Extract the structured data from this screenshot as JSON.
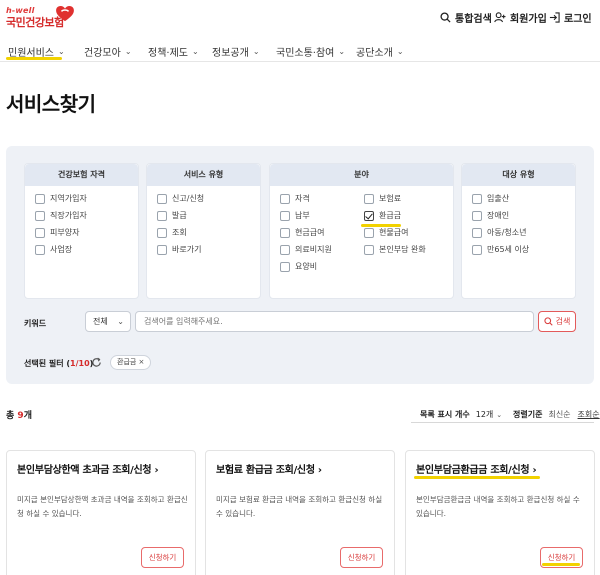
{
  "header": {
    "logo_tagline": "h-well",
    "logo_name": "국민건강보험",
    "search_label": "통합검색",
    "signup_label": "회원가입",
    "login_label": "로그인"
  },
  "nav": {
    "items": [
      {
        "label": "민원서비스",
        "active": true
      },
      {
        "label": "건강모아"
      },
      {
        "label": "정책·제도"
      },
      {
        "label": "정보공개"
      },
      {
        "label": "국민소통·참여"
      },
      {
        "label": "공단소개"
      }
    ]
  },
  "page_title": "서비스찾기",
  "filters": {
    "categories": [
      {
        "title": "건강보험 자격",
        "options": [
          {
            "label": "지역가입자",
            "checked": false
          },
          {
            "label": "직장가입자",
            "checked": false
          },
          {
            "label": "피부양자",
            "checked": false
          },
          {
            "label": "사업장",
            "checked": false
          }
        ]
      },
      {
        "title": "서비스 유형",
        "options": [
          {
            "label": "신고/신청",
            "checked": false
          },
          {
            "label": "발급",
            "checked": false
          },
          {
            "label": "조회",
            "checked": false
          },
          {
            "label": "바로가기",
            "checked": false
          }
        ]
      },
      {
        "title": "분야",
        "options": [
          {
            "label": "자격",
            "checked": false
          },
          {
            "label": "보험료",
            "checked": false
          },
          {
            "label": "납부",
            "checked": false
          },
          {
            "label": "환급금",
            "checked": true
          },
          {
            "label": "현금급여",
            "checked": false
          },
          {
            "label": "현물급여",
            "checked": false
          },
          {
            "label": "의료비지원",
            "checked": false
          },
          {
            "label": "본인부담 완화",
            "checked": false
          },
          {
            "label": "요양비",
            "checked": false
          }
        ]
      },
      {
        "title": "대상 유형",
        "options": [
          {
            "label": "임출산",
            "checked": false
          },
          {
            "label": "장애인",
            "checked": false
          },
          {
            "label": "아동/청소년",
            "checked": false
          },
          {
            "label": "만65세 이상",
            "checked": false
          }
        ]
      }
    ],
    "keyword_label": "키워드",
    "keyword_scope": "전체",
    "keyword_placeholder": "검색어를 입력해주세요.",
    "search_button": "검색",
    "selected_label": "선택된 필터",
    "selected_count": "1/10",
    "selected_chips": [
      "환급금 ×"
    ]
  },
  "results": {
    "total_prefix": "총 ",
    "total_count": "9",
    "total_suffix": "개",
    "per_page_label": "목록 표시 개수",
    "per_page_value": "12개",
    "sort_label": "정렬기준",
    "sort_latest": "최신순",
    "sort_name": "조회순",
    "cards": [
      {
        "title": "본인부담상한액 초과금 조회/신청",
        "desc": "미지급 본인부담상한액 초과금 내역을 조회하고 환급신청 하실 수 있습니다.",
        "button": "신청하기"
      },
      {
        "title": "보험료 환급금 조회/신청",
        "desc": "미지급 보험료 환급금 내역을 조회하고 환급신청 하실 수 있습니다.",
        "button": "신청하기"
      },
      {
        "title": "본인부담금환급금 조회/신청",
        "desc": "본인부담금환급금 내역을 조회하고 환급신청 하실 수 있습니다.",
        "button": "신청하기"
      }
    ]
  },
  "colors": {
    "brand_red": "#d52b2b",
    "highlight_yellow": "#f2d200",
    "panel_bg": "#eef1f6"
  }
}
